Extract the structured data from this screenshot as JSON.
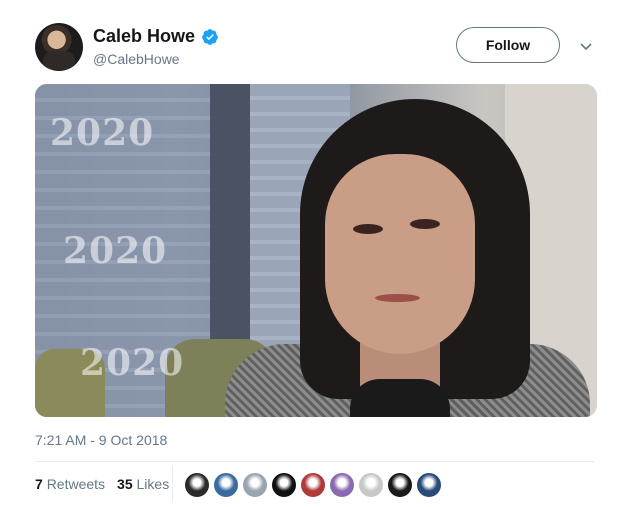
{
  "author": {
    "name": "Caleb Howe",
    "handle": "@CalebHowe",
    "verified_icon": "verified-badge-icon"
  },
  "actions": {
    "follow_label": "Follow",
    "more_icon": "chevron-down-icon"
  },
  "media": {
    "watermark_text": [
      "2020",
      "2020",
      "2020"
    ]
  },
  "tweet": {
    "timestamp": "7:21 AM - 9 Oct 2018"
  },
  "stats": {
    "retweets_count": "7",
    "retweets_label": "Retweets",
    "likes_count": "35",
    "likes_label": "Likes"
  },
  "likers": [
    {
      "color": "#2b2b2b"
    },
    {
      "color": "#3a6aa0"
    },
    {
      "color": "#9aa4ae"
    },
    {
      "color": "#111111"
    },
    {
      "color": "#b03a3a"
    },
    {
      "color": "#8a6ab0"
    },
    {
      "color": "#c8c8c8"
    },
    {
      "color": "#1a1a1a"
    },
    {
      "color": "#2a4a7a"
    }
  ],
  "colors": {
    "verified": "#1da1f2",
    "secondary_text": "#657786"
  }
}
